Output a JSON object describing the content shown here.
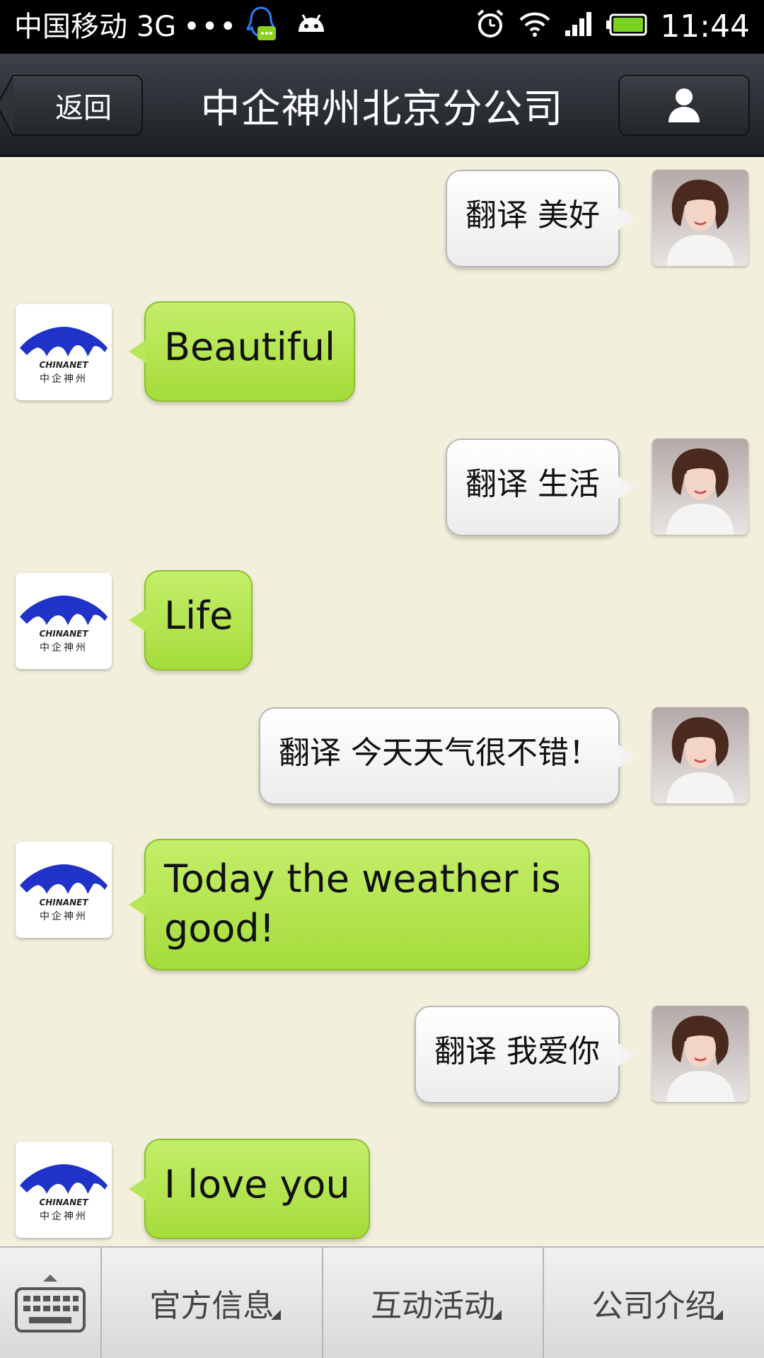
{
  "status_bar": {
    "carrier": "中国移动 3G",
    "dots": "•••",
    "time": "11:44",
    "icons": [
      "qq-icon",
      "android-icon",
      "alarm-icon",
      "wifi-icon",
      "signal-icon",
      "battery-icon"
    ]
  },
  "header": {
    "back_label": "返回",
    "title": "中企神州北京分公司",
    "profile_icon": "person-icon"
  },
  "colors": {
    "chat_background": "#f2efdc",
    "incoming_bubble": "#b5e552",
    "outgoing_bubble": "#f5f5f5",
    "header": "#2b3035",
    "logo_blue": "#1f33c8"
  },
  "logo": {
    "brand": "CHINANET",
    "brand_cn": "中企神州"
  },
  "messages": [
    {
      "side": "out",
      "text": "翻译 美好"
    },
    {
      "side": "in",
      "text": "Beautiful"
    },
    {
      "side": "out",
      "text": "翻译 生活"
    },
    {
      "side": "in",
      "text": "Life"
    },
    {
      "side": "out",
      "text": "翻译 今天天气很不错！"
    },
    {
      "side": "in",
      "text": "Today the weather is good!"
    },
    {
      "side": "out",
      "text": "翻译 我爱你"
    },
    {
      "side": "in",
      "text": "I love you"
    }
  ],
  "bottom_menu": {
    "keyboard_icon": "keyboard-icon",
    "items": [
      {
        "label": "官方信息"
      },
      {
        "label": "互动活动"
      },
      {
        "label": "公司介绍"
      }
    ]
  }
}
